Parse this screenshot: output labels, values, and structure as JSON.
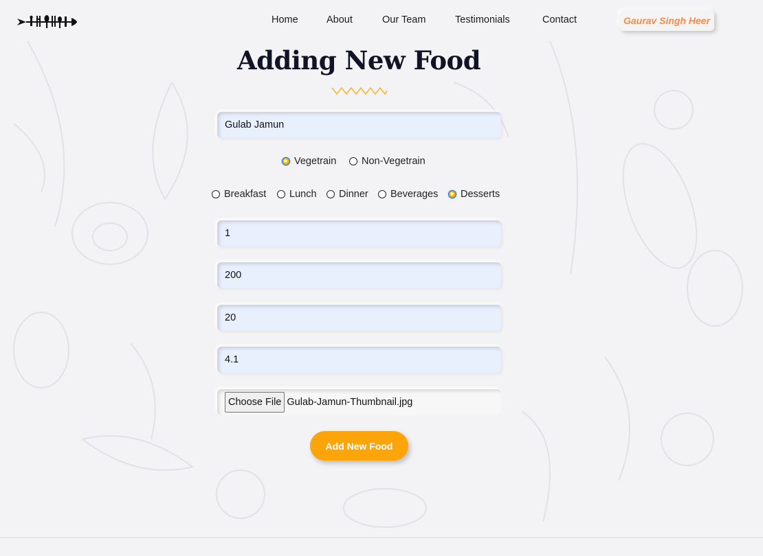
{
  "nav": {
    "links": [
      "Home",
      "About",
      "Our Team",
      "Testimonials",
      "Contact"
    ],
    "user_name": "Gaurav Singh Heer"
  },
  "page_title": "Adding New Food",
  "form": {
    "food_name": "Gulab Jamun",
    "type_options": [
      {
        "label": "Vegetrain",
        "checked": true
      },
      {
        "label": "Non-Vegetrain",
        "checked": false
      }
    ],
    "category_options": [
      {
        "label": "Breakfast",
        "checked": false
      },
      {
        "label": "Lunch",
        "checked": false
      },
      {
        "label": "Dinner",
        "checked": false
      },
      {
        "label": "Beverages",
        "checked": false
      },
      {
        "label": "Desserts",
        "checked": true
      }
    ],
    "quantity": "1",
    "price": "200",
    "time": "20",
    "rating": "4.1",
    "file_button_label": "Choose File",
    "file_name": "Gulab-Jamun-Thumbnail.jpg",
    "submit_label": "Add New Food"
  },
  "colors": {
    "accent": "#fba50a",
    "user_badge_text": "#f48a4d",
    "input_bg": "#e8effd"
  }
}
